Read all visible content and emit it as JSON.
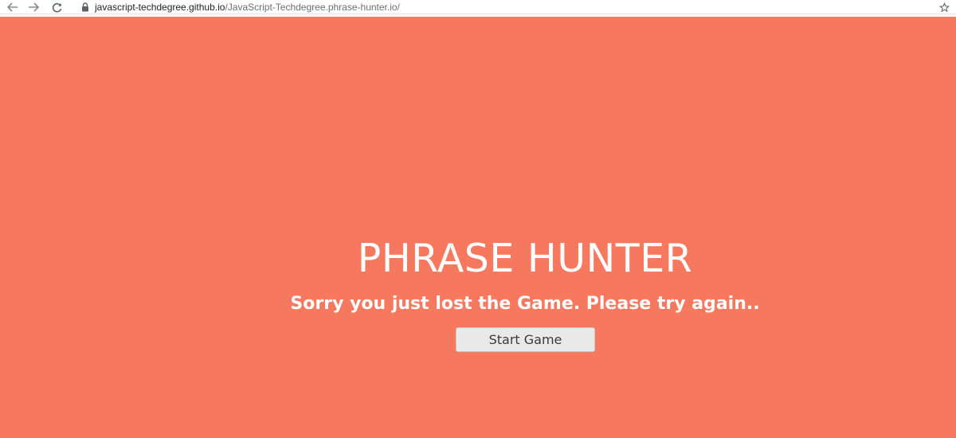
{
  "browser": {
    "url_host": "javascript-techdegree.github.io",
    "url_path": "/JavaScript-Techdegree.phrase-hunter.io/",
    "icons": {
      "back": "back-arrow-icon",
      "forward": "forward-arrow-icon",
      "reload": "reload-icon",
      "lock": "lock-icon",
      "bookmark": "star-icon"
    }
  },
  "overlay": {
    "title": "PHRASE HUNTER",
    "message": "Sorry you just lost the Game. Please try again..",
    "start_button": "Start Game",
    "background_color": "#f5785f"
  }
}
